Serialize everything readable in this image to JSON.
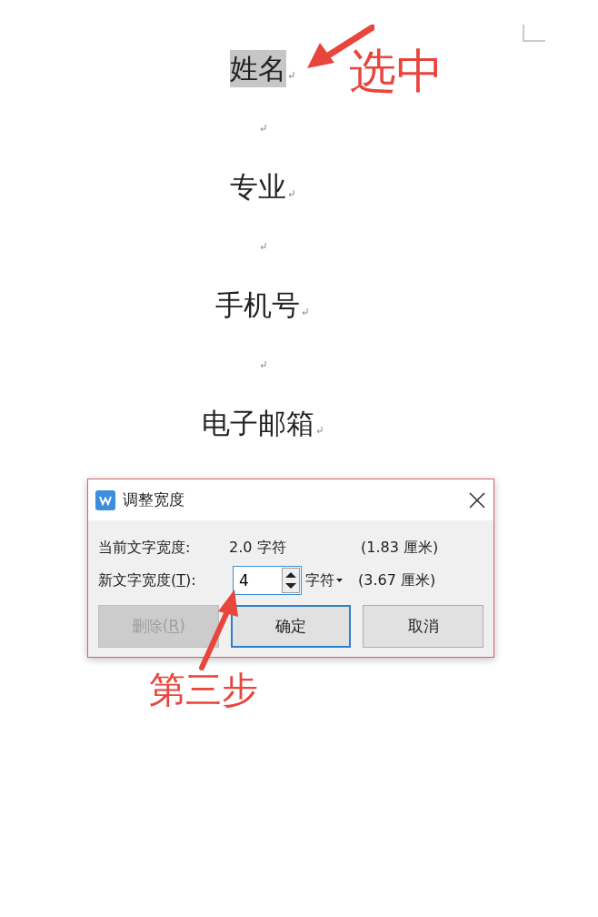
{
  "document": {
    "paragraphs": [
      {
        "kind": "text",
        "text": "姓名",
        "selected": true
      },
      {
        "kind": "empty"
      },
      {
        "kind": "text",
        "text": "专业",
        "selected": false
      },
      {
        "kind": "empty"
      },
      {
        "kind": "text",
        "text": "手机号",
        "selected": false
      },
      {
        "kind": "empty"
      },
      {
        "kind": "text",
        "text": "电子邮箱",
        "selected": false
      }
    ]
  },
  "dialog": {
    "title": "调整宽度",
    "current_row": {
      "label": "当前文字宽度:",
      "value": "2.0 字符",
      "metric": "(1.83 厘米)"
    },
    "new_row": {
      "label_before": "新文字宽度(",
      "mnemonic": "T",
      "label_after": "):",
      "value": "4",
      "unit": "字符",
      "metric": "(3.67 厘米)"
    },
    "buttons": [
      {
        "label_before": "删除(",
        "mnemonic": "R",
        "label_after": ")",
        "disabled": true,
        "default": false
      },
      {
        "label": "确定",
        "disabled": false,
        "default": true
      },
      {
        "label": "取消",
        "disabled": false,
        "default": false
      }
    ]
  },
  "annotations": [
    {
      "text": "选中"
    },
    {
      "text": "第三步"
    }
  ]
}
